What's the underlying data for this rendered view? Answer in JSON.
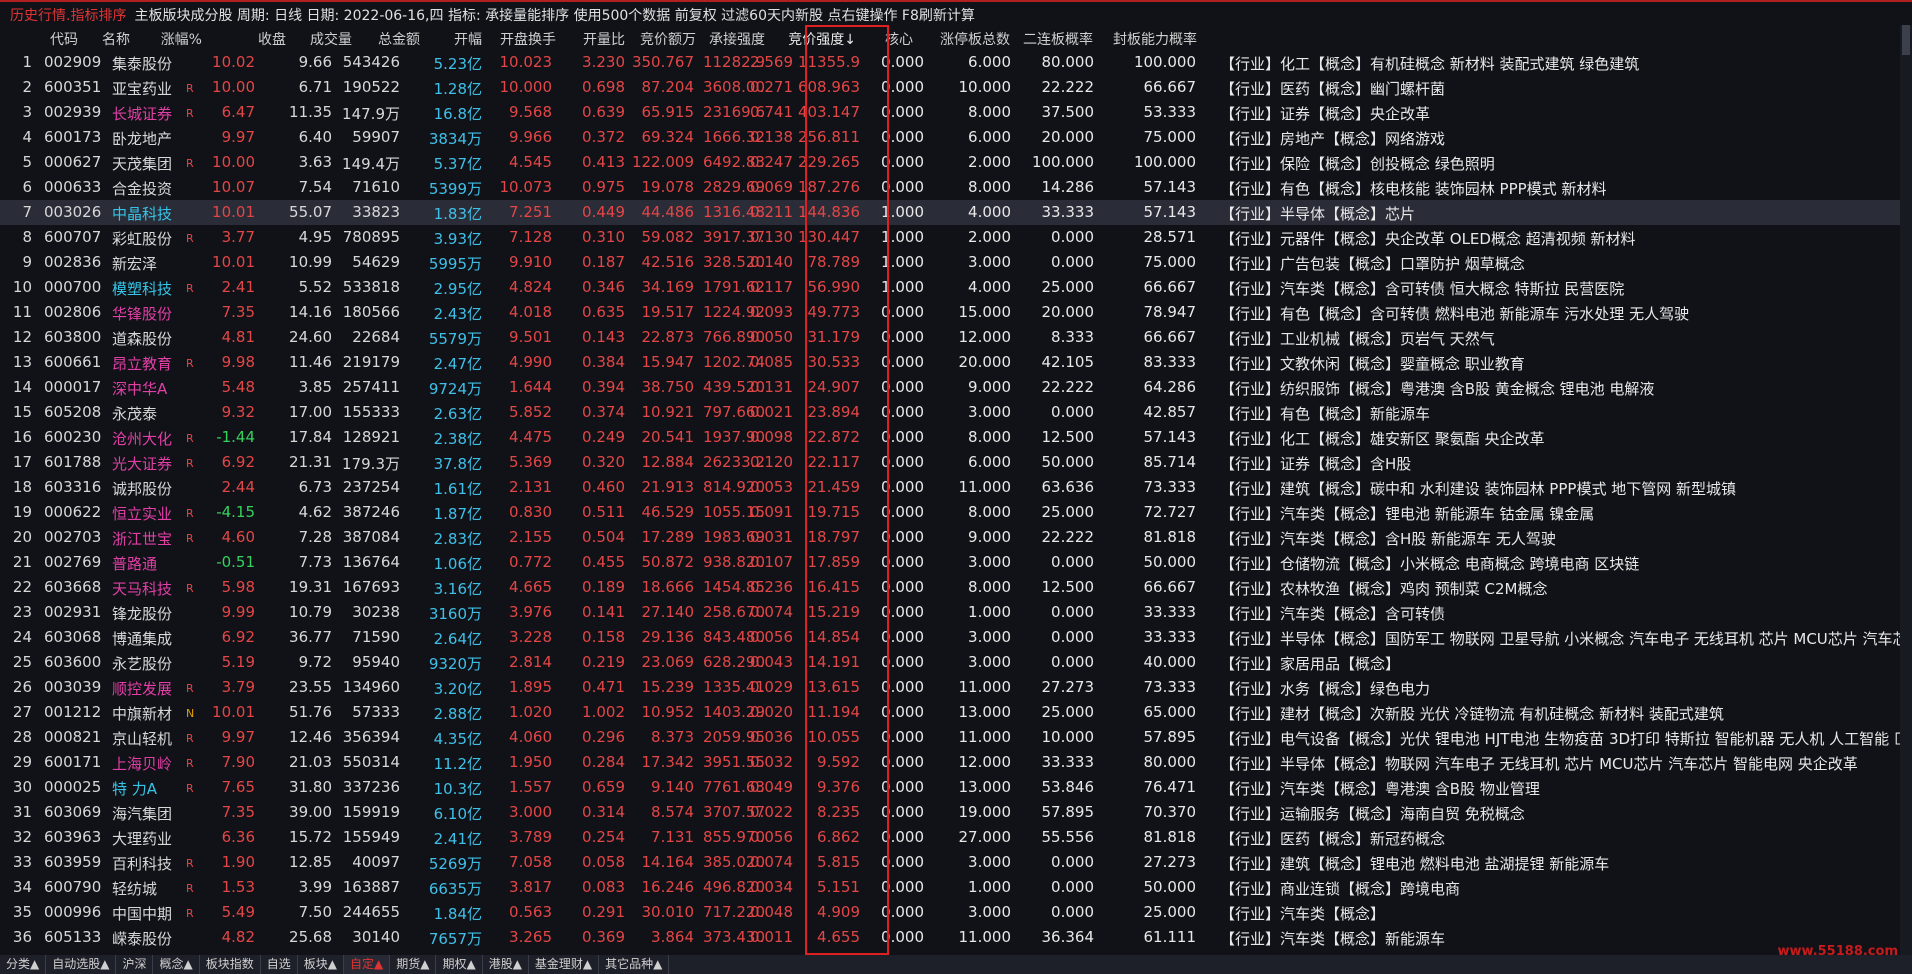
{
  "topbar": {
    "title": "历史行情.指标排序",
    "info": "主板版块成分股 周期: 日线 日期: 2022-06-16,四 指标: 承接量能排序  使用500个数据 前复权 过滤60天内新股 点右键操作 F8刷新计算"
  },
  "headers": [
    "代码",
    "名称",
    "涨幅%",
    "收盘",
    "成交量",
    "总金额",
    "开幅",
    "开盘换手",
    "开量比",
    "竞价额万",
    "承接强度",
    "竞价强度↓",
    "核心",
    "涨停板总数",
    "二连板概率",
    "封板能力概率"
  ],
  "rows": [
    {
      "n": "1",
      "code": "002909",
      "name": "集泰股份",
      "nc": "",
      "flag": "",
      "chg": "10.02",
      "close": "9.66",
      "vol": "543426",
      "amt": "5.23亿",
      "open": "10.023",
      "tov": "3.230",
      "vr": "350.767",
      "bid": "11282.9",
      "str": "2.569",
      "bs": "11355.9",
      "core": "0.000",
      "zt": "6.000",
      "p2": "80.000",
      "seal": "100.000",
      "tags": "【行业】化工【概念】有机硅概念 新材料 装配式建筑 绿色建筑"
    },
    {
      "n": "2",
      "code": "600351",
      "name": "亚宝药业",
      "nc": "",
      "flag": "R",
      "chg": "10.00",
      "close": "6.71",
      "vol": "190522",
      "amt": "1.28亿",
      "open": "10.000",
      "tov": "0.698",
      "vr": "87.204",
      "bid": "3608.00",
      "str": "0.271",
      "bs": "608.963",
      "core": "0.000",
      "zt": "10.000",
      "p2": "22.222",
      "seal": "66.667",
      "tags": "【行业】医药【概念】幽门螺杆菌"
    },
    {
      "n": "3",
      "code": "002939",
      "name": "长城证券",
      "nc": "m",
      "flag": "R",
      "chg": "6.47",
      "close": "11.35",
      "vol": "147.9万",
      "amt": "16.8亿",
      "open": "9.568",
      "tov": "0.639",
      "vr": "65.915",
      "bid": "23169.6",
      "str": "0.741",
      "bs": "403.147",
      "core": "0.000",
      "zt": "8.000",
      "p2": "37.500",
      "seal": "53.333",
      "tags": "【行业】证券【概念】央企改革"
    },
    {
      "n": "4",
      "code": "600173",
      "name": "卧龙地产",
      "nc": "",
      "flag": "",
      "chg": "9.97",
      "close": "6.40",
      "vol": "59907",
      "amt": "3834万",
      "open": "9.966",
      "tov": "0.372",
      "vr": "69.324",
      "bid": "1666.32",
      "str": "0.138",
      "bs": "256.811",
      "core": "0.000",
      "zt": "6.000",
      "p2": "20.000",
      "seal": "75.000",
      "tags": "【行业】房地产【概念】网络游戏"
    },
    {
      "n": "5",
      "code": "000627",
      "name": "天茂集团",
      "nc": "",
      "flag": "R",
      "chg": "10.00",
      "close": "3.63",
      "vol": "149.4万",
      "amt": "5.37亿",
      "open": "4.545",
      "tov": "0.413",
      "vr": "122.009",
      "bid": "6492.83",
      "str": "0.247",
      "bs": "229.265",
      "core": "0.000",
      "zt": "2.000",
      "p2": "100.000",
      "seal": "100.000",
      "tags": "【行业】保险【概念】创投概念 绿色照明"
    },
    {
      "n": "6",
      "code": "000633",
      "name": "合金投资",
      "nc": "",
      "flag": "",
      "chg": "10.07",
      "close": "7.54",
      "vol": "71610",
      "amt": "5399万",
      "open": "10.073",
      "tov": "0.975",
      "vr": "19.078",
      "bid": "2829.69",
      "str": "0.069",
      "bs": "187.276",
      "core": "0.000",
      "zt": "8.000",
      "p2": "14.286",
      "seal": "57.143",
      "tags": "【行业】有色【概念】核电核能 装饰园林 PPP模式 新材料"
    },
    {
      "n": "7",
      "code": "003026",
      "name": "中晶科技",
      "nc": "c",
      "flag": "",
      "chg": "10.01",
      "close": "55.07",
      "vol": "33823",
      "amt": "1.83亿",
      "open": "7.251",
      "tov": "0.449",
      "vr": "44.486",
      "bid": "1316.48",
      "str": "0.211",
      "bs": "144.836",
      "core": "1.000",
      "zt": "4.000",
      "p2": "33.333",
      "seal": "57.143",
      "tags": "【行业】半导体【概念】芯片",
      "sel": true
    },
    {
      "n": "8",
      "code": "600707",
      "name": "彩虹股份",
      "nc": "",
      "flag": "R",
      "chg": "3.77",
      "close": "4.95",
      "vol": "780895",
      "amt": "3.93亿",
      "open": "7.128",
      "tov": "0.310",
      "vr": "59.082",
      "bid": "3917.37",
      "str": "0.130",
      "bs": "130.447",
      "core": "1.000",
      "zt": "2.000",
      "p2": "0.000",
      "seal": "28.571",
      "tags": "【行业】元器件【概念】央企改革 OLED概念 超清视频 新材料"
    },
    {
      "n": "9",
      "code": "002836",
      "name": "新宏泽",
      "nc": "",
      "flag": "",
      "chg": "10.01",
      "close": "10.99",
      "vol": "54629",
      "amt": "5995万",
      "open": "9.910",
      "tov": "0.187",
      "vr": "42.516",
      "bid": "328.520",
      "str": "0.140",
      "bs": "78.789",
      "core": "1.000",
      "zt": "3.000",
      "p2": "0.000",
      "seal": "75.000",
      "tags": "【行业】广告包装【概念】口罩防护 烟草概念"
    },
    {
      "n": "10",
      "code": "000700",
      "name": "模塑科技",
      "nc": "c",
      "flag": "R",
      "chg": "2.41",
      "close": "5.52",
      "vol": "533818",
      "amt": "2.95亿",
      "open": "4.824",
      "tov": "0.346",
      "vr": "34.169",
      "bid": "1791.62",
      "str": "0.117",
      "bs": "56.990",
      "core": "1.000",
      "zt": "4.000",
      "p2": "25.000",
      "seal": "66.667",
      "tags": "【行业】汽车类【概念】含可转债 恒大概念 特斯拉 民营医院"
    },
    {
      "n": "11",
      "code": "002806",
      "name": "华锋股份",
      "nc": "m",
      "flag": "",
      "chg": "7.35",
      "close": "14.16",
      "vol": "180566",
      "amt": "2.43亿",
      "open": "4.018",
      "tov": "0.635",
      "vr": "19.517",
      "bid": "1224.92",
      "str": "0.093",
      "bs": "49.773",
      "core": "0.000",
      "zt": "15.000",
      "p2": "20.000",
      "seal": "78.947",
      "tags": "【行业】有色【概念】含可转债 燃料电池 新能源车 污水处理 无人驾驶"
    },
    {
      "n": "12",
      "code": "603800",
      "name": "道森股份",
      "nc": "",
      "flag": "",
      "chg": "4.81",
      "close": "24.60",
      "vol": "22684",
      "amt": "5579万",
      "open": "9.501",
      "tov": "0.143",
      "vr": "22.873",
      "bid": "766.890",
      "str": "0.050",
      "bs": "31.179",
      "core": "0.000",
      "zt": "12.000",
      "p2": "8.333",
      "seal": "66.667",
      "tags": "【行业】工业机械【概念】页岩气 天然气"
    },
    {
      "n": "13",
      "code": "600661",
      "name": "昂立教育",
      "nc": "m",
      "flag": "R",
      "chg": "9.98",
      "close": "11.46",
      "vol": "219179",
      "amt": "2.47亿",
      "open": "4.990",
      "tov": "0.384",
      "vr": "15.947",
      "bid": "1202.74",
      "str": "0.085",
      "bs": "30.533",
      "core": "0.000",
      "zt": "20.000",
      "p2": "42.105",
      "seal": "83.333",
      "tags": "【行业】文教休闲【概念】婴童概念 职业教育"
    },
    {
      "n": "14",
      "code": "000017",
      "name": "深中华A",
      "nc": "m",
      "flag": "",
      "chg": "5.48",
      "close": "3.85",
      "vol": "257411",
      "amt": "9724万",
      "open": "1.644",
      "tov": "0.394",
      "vr": "38.750",
      "bid": "439.520",
      "str": "0.131",
      "bs": "24.907",
      "core": "0.000",
      "zt": "9.000",
      "p2": "22.222",
      "seal": "64.286",
      "tags": "【行业】纺织服饰【概念】粤港澳 含B股 黄金概念 锂电池 电解液"
    },
    {
      "n": "15",
      "code": "605208",
      "name": "永茂泰",
      "nc": "",
      "flag": "",
      "chg": "9.32",
      "close": "17.00",
      "vol": "155333",
      "amt": "2.63亿",
      "open": "5.852",
      "tov": "0.374",
      "vr": "10.921",
      "bid": "797.660",
      "str": "0.021",
      "bs": "23.894",
      "core": "0.000",
      "zt": "3.000",
      "p2": "0.000",
      "seal": "42.857",
      "tags": "【行业】有色【概念】新能源车"
    },
    {
      "n": "16",
      "code": "600230",
      "name": "沧州大化",
      "nc": "m",
      "flag": "R",
      "chg": "-1.44",
      "close": "17.84",
      "vol": "128921",
      "amt": "2.38亿",
      "open": "4.475",
      "tov": "0.249",
      "vr": "20.541",
      "bid": "1937.90",
      "str": "0.098",
      "bs": "22.872",
      "core": "0.000",
      "zt": "8.000",
      "p2": "12.500",
      "seal": "57.143",
      "tags": "【行业】化工【概念】雄安新区 聚氨酯 央企改革"
    },
    {
      "n": "17",
      "code": "601788",
      "name": "光大证券",
      "nc": "m",
      "flag": "R",
      "chg": "6.92",
      "close": "21.31",
      "vol": "179.3万",
      "amt": "37.8亿",
      "open": "5.369",
      "tov": "0.320",
      "vr": "12.884",
      "bid": "26233.2",
      "str": "0.120",
      "bs": "22.117",
      "core": "0.000",
      "zt": "6.000",
      "p2": "50.000",
      "seal": "85.714",
      "tags": "【行业】证券【概念】含H股"
    },
    {
      "n": "18",
      "code": "603316",
      "name": "诚邦股份",
      "nc": "",
      "flag": "",
      "chg": "2.44",
      "close": "6.73",
      "vol": "237254",
      "amt": "1.61亿",
      "open": "2.131",
      "tov": "0.460",
      "vr": "21.913",
      "bid": "814.920",
      "str": "0.053",
      "bs": "21.459",
      "core": "0.000",
      "zt": "11.000",
      "p2": "63.636",
      "seal": "73.333",
      "tags": "【行业】建筑【概念】碳中和 水利建设 装饰园林 PPP模式 地下管网 新型城镇"
    },
    {
      "n": "19",
      "code": "000622",
      "name": "恒立实业",
      "nc": "m",
      "flag": "R",
      "chg": "-4.15",
      "close": "4.62",
      "vol": "387246",
      "amt": "1.87亿",
      "open": "0.830",
      "tov": "0.511",
      "vr": "46.529",
      "bid": "1055.15",
      "str": "0.091",
      "bs": "19.715",
      "core": "0.000",
      "zt": "8.000",
      "p2": "25.000",
      "seal": "72.727",
      "tags": "【行业】汽车类【概念】锂电池 新能源车 钴金属 镍金属"
    },
    {
      "n": "20",
      "code": "002703",
      "name": "浙江世宝",
      "nc": "m",
      "flag": "R",
      "chg": "4.60",
      "close": "7.28",
      "vol": "387084",
      "amt": "2.83亿",
      "open": "2.155",
      "tov": "0.504",
      "vr": "17.289",
      "bid": "1983.69",
      "str": "0.031",
      "bs": "18.797",
      "core": "0.000",
      "zt": "9.000",
      "p2": "22.222",
      "seal": "81.818",
      "tags": "【行业】汽车类【概念】含H股 新能源车 无人驾驶"
    },
    {
      "n": "21",
      "code": "002769",
      "name": "普路通",
      "nc": "m",
      "flag": "",
      "chg": "-0.51",
      "close": "7.73",
      "vol": "136764",
      "amt": "1.06亿",
      "open": "0.772",
      "tov": "0.455",
      "vr": "50.872",
      "bid": "938.820",
      "str": "0.107",
      "bs": "17.859",
      "core": "0.000",
      "zt": "3.000",
      "p2": "0.000",
      "seal": "50.000",
      "tags": "【行业】仓储物流【概念】小米概念 电商概念 跨境电商 区块链"
    },
    {
      "n": "22",
      "code": "603668",
      "name": "天马科技",
      "nc": "m",
      "flag": "R",
      "chg": "5.98",
      "close": "19.31",
      "vol": "167693",
      "amt": "3.16亿",
      "open": "4.665",
      "tov": "0.189",
      "vr": "18.666",
      "bid": "1454.85",
      "str": "0.236",
      "bs": "16.415",
      "core": "0.000",
      "zt": "8.000",
      "p2": "12.500",
      "seal": "66.667",
      "tags": "【行业】农林牧渔【概念】鸡肉 预制菜 C2M概念"
    },
    {
      "n": "23",
      "code": "002931",
      "name": "锋龙股份",
      "nc": "",
      "flag": "",
      "chg": "9.99",
      "close": "10.79",
      "vol": "30238",
      "amt": "3160万",
      "open": "3.976",
      "tov": "0.141",
      "vr": "27.140",
      "bid": "258.670",
      "str": "0.074",
      "bs": "15.219",
      "core": "0.000",
      "zt": "1.000",
      "p2": "0.000",
      "seal": "33.333",
      "tags": "【行业】汽车类【概念】含可转债"
    },
    {
      "n": "24",
      "code": "603068",
      "name": "博通集成",
      "nc": "",
      "flag": "",
      "chg": "6.92",
      "close": "36.77",
      "vol": "71590",
      "amt": "2.64亿",
      "open": "3.228",
      "tov": "0.158",
      "vr": "29.136",
      "bid": "843.480",
      "str": "0.056",
      "bs": "14.854",
      "core": "0.000",
      "zt": "3.000",
      "p2": "0.000",
      "seal": "33.333",
      "tags": "【行业】半导体【概念】国防军工 物联网 卫星导航 小米概念 汽车电子 无线耳机 芯片 MCU芯片 汽车芯"
    },
    {
      "n": "25",
      "code": "603600",
      "name": "永艺股份",
      "nc": "",
      "flag": "",
      "chg": "5.19",
      "close": "9.72",
      "vol": "95940",
      "amt": "9320万",
      "open": "2.814",
      "tov": "0.219",
      "vr": "23.069",
      "bid": "628.290",
      "str": "0.043",
      "bs": "14.191",
      "core": "0.000",
      "zt": "3.000",
      "p2": "0.000",
      "seal": "40.000",
      "tags": "【行业】家居用品【概念】"
    },
    {
      "n": "26",
      "code": "003039",
      "name": "顺控发展",
      "nc": "m",
      "flag": "R",
      "chg": "3.79",
      "close": "23.55",
      "vol": "134960",
      "amt": "3.20亿",
      "open": "1.895",
      "tov": "0.471",
      "vr": "15.239",
      "bid": "1335.41",
      "str": "0.029",
      "bs": "13.615",
      "core": "0.000",
      "zt": "11.000",
      "p2": "27.273",
      "seal": "73.333",
      "tags": "【行业】水务【概念】绿色电力"
    },
    {
      "n": "27",
      "code": "001212",
      "name": "中旗新材",
      "nc": "",
      "flag": "N",
      "chg": "10.01",
      "close": "51.76",
      "vol": "57333",
      "amt": "2.88亿",
      "open": "1.020",
      "tov": "1.002",
      "vr": "10.952",
      "bid": "1403.29",
      "str": "0.020",
      "bs": "11.194",
      "core": "0.000",
      "zt": "13.000",
      "p2": "25.000",
      "seal": "65.000",
      "tags": "【行业】建材【概念】次新股 光伏 冷链物流 有机硅概念 新材料 装配式建筑"
    },
    {
      "n": "28",
      "code": "000821",
      "name": "京山轻机",
      "nc": "",
      "flag": "R",
      "chg": "9.97",
      "close": "12.46",
      "vol": "356394",
      "amt": "4.35亿",
      "open": "4.060",
      "tov": "0.296",
      "vr": "8.373",
      "bid": "2059.95",
      "str": "0.036",
      "bs": "10.055",
      "core": "0.000",
      "zt": "11.000",
      "p2": "10.000",
      "seal": "57.895",
      "tags": "【行业】电气设备【概念】光伏 锂电池 HJT电池 生物疫苗 3D打印 特斯拉 智能机器 无人机 人工智能 匚"
    },
    {
      "n": "29",
      "code": "600171",
      "name": "上海贝岭",
      "nc": "m",
      "flag": "R",
      "chg": "7.90",
      "close": "21.03",
      "vol": "550314",
      "amt": "11.2亿",
      "open": "1.950",
      "tov": "0.284",
      "vr": "17.342",
      "bid": "3951.55",
      "str": "0.032",
      "bs": "9.592",
      "core": "0.000",
      "zt": "12.000",
      "p2": "33.333",
      "seal": "80.000",
      "tags": "【行业】半导体【概念】物联网 汽车电子 无线耳机 芯片 MCU芯片 汽车芯片 智能电网 央企改革"
    },
    {
      "n": "30",
      "code": "000025",
      "name": "特 力A",
      "nc": "c",
      "flag": "R",
      "chg": "7.65",
      "close": "31.80",
      "vol": "337236",
      "amt": "10.3亿",
      "open": "1.557",
      "tov": "0.659",
      "vr": "9.140",
      "bid": "7761.63",
      "str": "0.049",
      "bs": "9.376",
      "core": "0.000",
      "zt": "13.000",
      "p2": "53.846",
      "seal": "76.471",
      "tags": "【行业】汽车类【概念】粤港澳 含B股 物业管理"
    },
    {
      "n": "31",
      "code": "603069",
      "name": "海汽集团",
      "nc": "",
      "flag": "",
      "chg": "7.35",
      "close": "39.00",
      "vol": "159919",
      "amt": "6.10亿",
      "open": "3.000",
      "tov": "0.314",
      "vr": "8.574",
      "bid": "3707.57",
      "str": "0.022",
      "bs": "8.235",
      "core": "0.000",
      "zt": "19.000",
      "p2": "57.895",
      "seal": "70.370",
      "tags": "【行业】运输服务【概念】海南自贸 免税概念"
    },
    {
      "n": "32",
      "code": "603963",
      "name": "大理药业",
      "nc": "",
      "flag": "",
      "chg": "6.36",
      "close": "15.72",
      "vol": "155949",
      "amt": "2.41亿",
      "open": "3.789",
      "tov": "0.254",
      "vr": "7.131",
      "bid": "855.970",
      "str": "0.056",
      "bs": "6.862",
      "core": "0.000",
      "zt": "27.000",
      "p2": "55.556",
      "seal": "81.818",
      "tags": "【行业】医药【概念】新冠药概念"
    },
    {
      "n": "33",
      "code": "603959",
      "name": "百利科技",
      "nc": "",
      "flag": "R",
      "chg": "1.90",
      "close": "12.85",
      "vol": "40097",
      "amt": "5269万",
      "open": "7.058",
      "tov": "0.058",
      "vr": "14.164",
      "bid": "385.020",
      "str": "0.074",
      "bs": "5.815",
      "core": "0.000",
      "zt": "3.000",
      "p2": "0.000",
      "seal": "27.273",
      "tags": "【行业】建筑【概念】锂电池 燃料电池 盐湖提锂 新能源车"
    },
    {
      "n": "34",
      "code": "600790",
      "name": "轻纺城",
      "nc": "",
      "flag": "R",
      "chg": "1.53",
      "close": "3.99",
      "vol": "163887",
      "amt": "6635万",
      "open": "3.817",
      "tov": "0.083",
      "vr": "16.246",
      "bid": "496.820",
      "str": "0.034",
      "bs": "5.151",
      "core": "0.000",
      "zt": "1.000",
      "p2": "0.000",
      "seal": "50.000",
      "tags": "【行业】商业连锁【概念】跨境电商"
    },
    {
      "n": "35",
      "code": "000996",
      "name": "中国中期",
      "nc": "",
      "flag": "R",
      "chg": "5.49",
      "close": "7.50",
      "vol": "244655",
      "amt": "1.84亿",
      "open": "0.563",
      "tov": "0.291",
      "vr": "30.010",
      "bid": "717.220",
      "str": "0.048",
      "bs": "4.909",
      "core": "0.000",
      "zt": "3.000",
      "p2": "0.000",
      "seal": "25.000",
      "tags": "【行业】汽车类【概念】"
    },
    {
      "n": "36",
      "code": "605133",
      "name": "嵘泰股份",
      "nc": "",
      "flag": "",
      "chg": "4.82",
      "close": "25.68",
      "vol": "30140",
      "amt": "7657万",
      "open": "3.265",
      "tov": "0.369",
      "vr": "3.864",
      "bid": "373.430",
      "str": "0.011",
      "bs": "4.655",
      "core": "0.000",
      "zt": "11.000",
      "p2": "36.364",
      "seal": "61.111",
      "tags": "【行业】汽车类【概念】新能源车"
    }
  ],
  "bottom_tabs": [
    "分类▲",
    "自动选股▲",
    "沪深",
    "概念▲",
    "板块指数",
    "自选",
    "板块▲",
    "自定▲",
    "期货▲",
    "期权▲",
    "港股▲",
    "基金理财▲",
    "其它品种▲"
  ],
  "watermark": "www.55188.com"
}
